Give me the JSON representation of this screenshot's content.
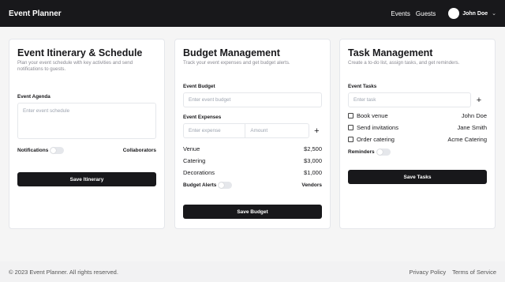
{
  "header": {
    "brand": "Event Planner",
    "nav": [
      "Events",
      "Guests"
    ],
    "user": "John Doe",
    "user_chevron_icon": "chevron-down-icon"
  },
  "itinerary": {
    "title": "Event Itinerary & Schedule",
    "subtitle": "Plan your event schedule with key activities and send notifications to guests.",
    "agenda_label": "Event Agenda",
    "agenda_placeholder": "Enter event schedule",
    "notifications_label": "Notifications",
    "collaborators_label": "Collaborators",
    "save_label": "Save Itinerary"
  },
  "budget": {
    "title": "Budget Management",
    "subtitle": "Track your event expenses and get budget alerts.",
    "event_budget_label": "Event Budget",
    "event_budget_placeholder": "Enter event budget",
    "expenses_label": "Event Expenses",
    "expense_placeholder": "Enter expense",
    "amount_placeholder": "Amount",
    "items": [
      {
        "name": "Venue",
        "amount": "$2,500"
      },
      {
        "name": "Catering",
        "amount": "$3,000"
      },
      {
        "name": "Decorations",
        "amount": "$1,000"
      }
    ],
    "alerts_label": "Budget Alerts",
    "vendors_label": "Vendors",
    "save_label": "Save Budget"
  },
  "tasks": {
    "title": "Task Management",
    "subtitle": "Create a to-do list, assign tasks, and get reminders.",
    "event_tasks_label": "Event Tasks",
    "task_placeholder": "Enter task",
    "items": [
      {
        "task": "Book venue",
        "assignee": "John Doe"
      },
      {
        "task": "Send invitations",
        "assignee": "Jane Smith"
      },
      {
        "task": "Order catering",
        "assignee": "Acme Catering"
      }
    ],
    "reminders_label": "Reminders",
    "save_label": "Save Tasks"
  },
  "footer": {
    "copyright": "© 2023 Event Planner. All rights reserved.",
    "links": [
      "Privacy Policy",
      "Terms of Service"
    ]
  }
}
